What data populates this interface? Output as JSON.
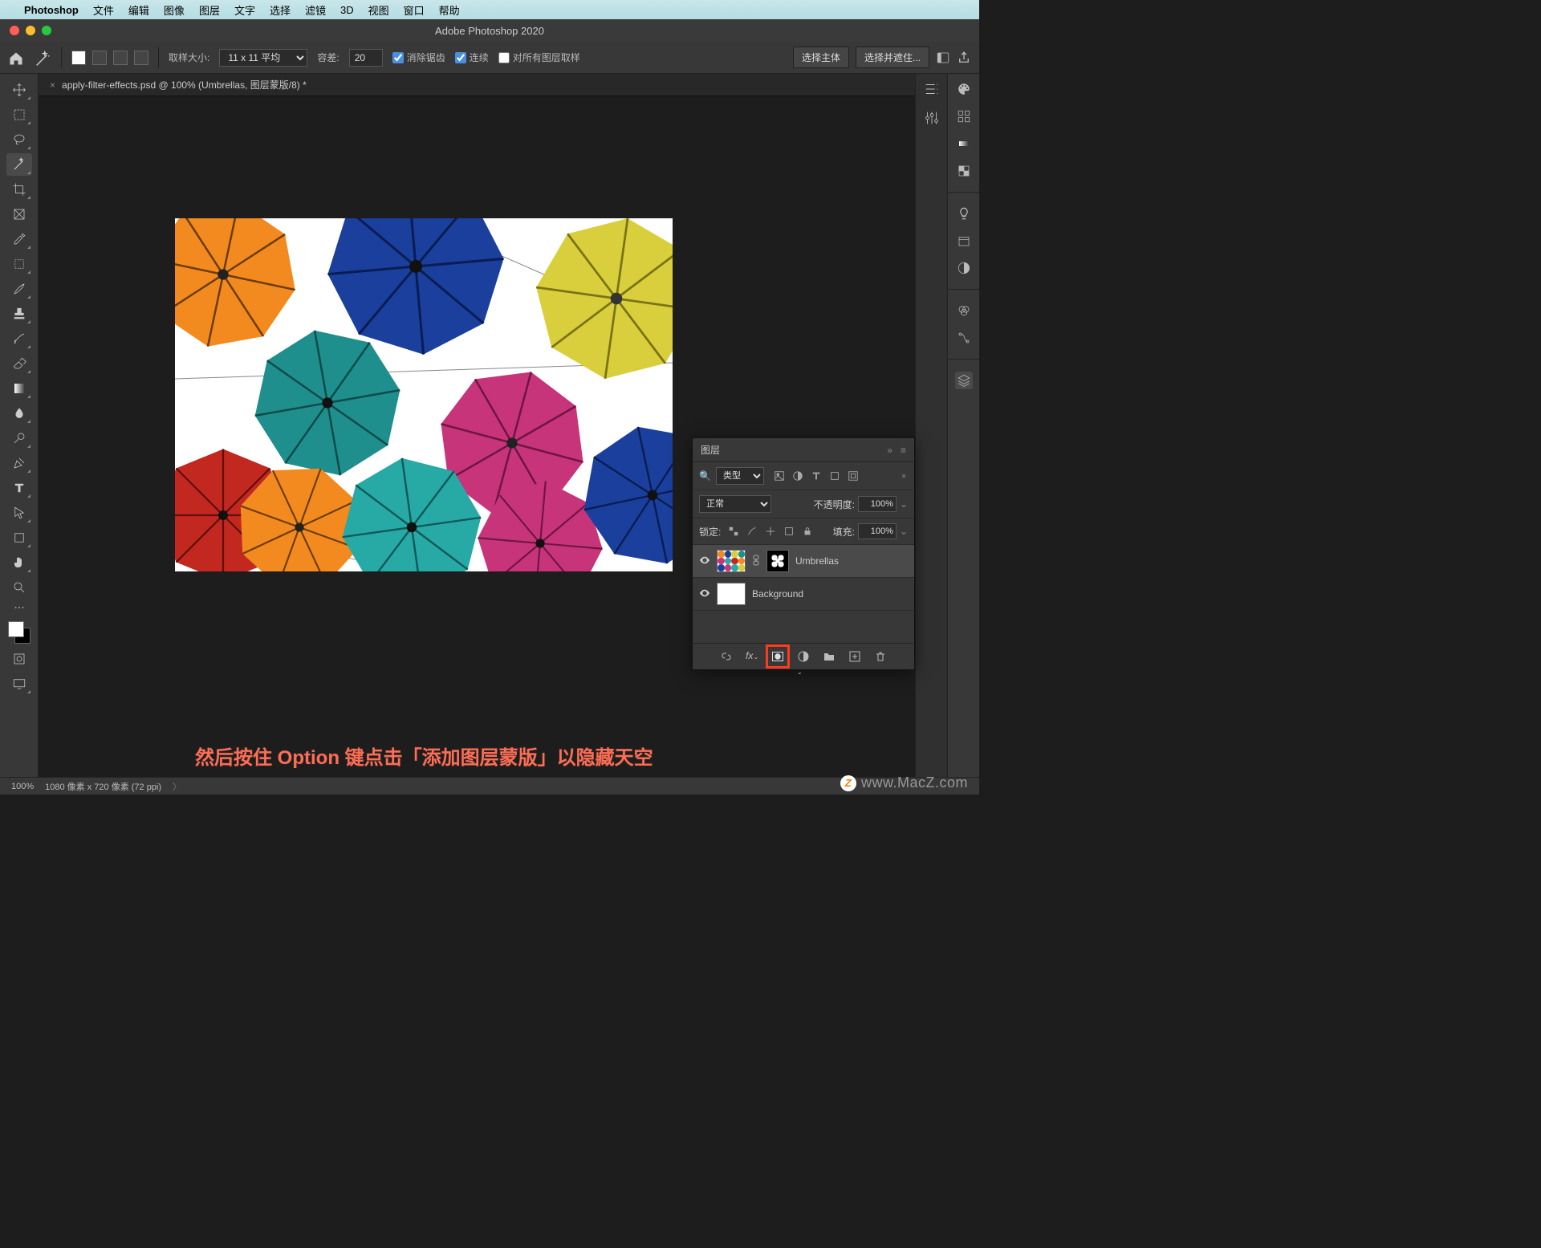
{
  "mac_menu": {
    "app": "Photoshop",
    "items": [
      "文件",
      "编辑",
      "图像",
      "图层",
      "文字",
      "选择",
      "滤镜",
      "3D",
      "视图",
      "窗口",
      "帮助"
    ]
  },
  "window": {
    "title": "Adobe Photoshop 2020"
  },
  "options": {
    "sample_label": "取样大小:",
    "sample_value": "11 x 11 平均",
    "tolerance_label": "容差:",
    "tolerance_value": "20",
    "antialias": "消除锯齿",
    "contiguous": "连续",
    "all_layers": "对所有图层取样",
    "select_subject": "选择主体",
    "select_mask": "选择并遮住..."
  },
  "doc": {
    "tab": "apply-filter-effects.psd @ 100% (Umbrellas, 图层蒙版/8) *"
  },
  "instruction": "然后按住 Option 键点击「添加图层蒙版」以隐藏天空",
  "layers_panel": {
    "title": "图层",
    "type_filter": "类型",
    "blend_mode": "正常",
    "opacity_label": "不透明度:",
    "opacity_value": "100%",
    "lock_label": "锁定:",
    "fill_label": "填充:",
    "fill_value": "100%",
    "layers": [
      {
        "name": "Umbrellas",
        "mask": true,
        "selected": true
      },
      {
        "name": "Background",
        "mask": false,
        "selected": false
      }
    ]
  },
  "status": {
    "zoom": "100%",
    "info": "1080 像素 x 720 像素 (72 ppi)"
  },
  "watermark": "www.MacZ.com"
}
